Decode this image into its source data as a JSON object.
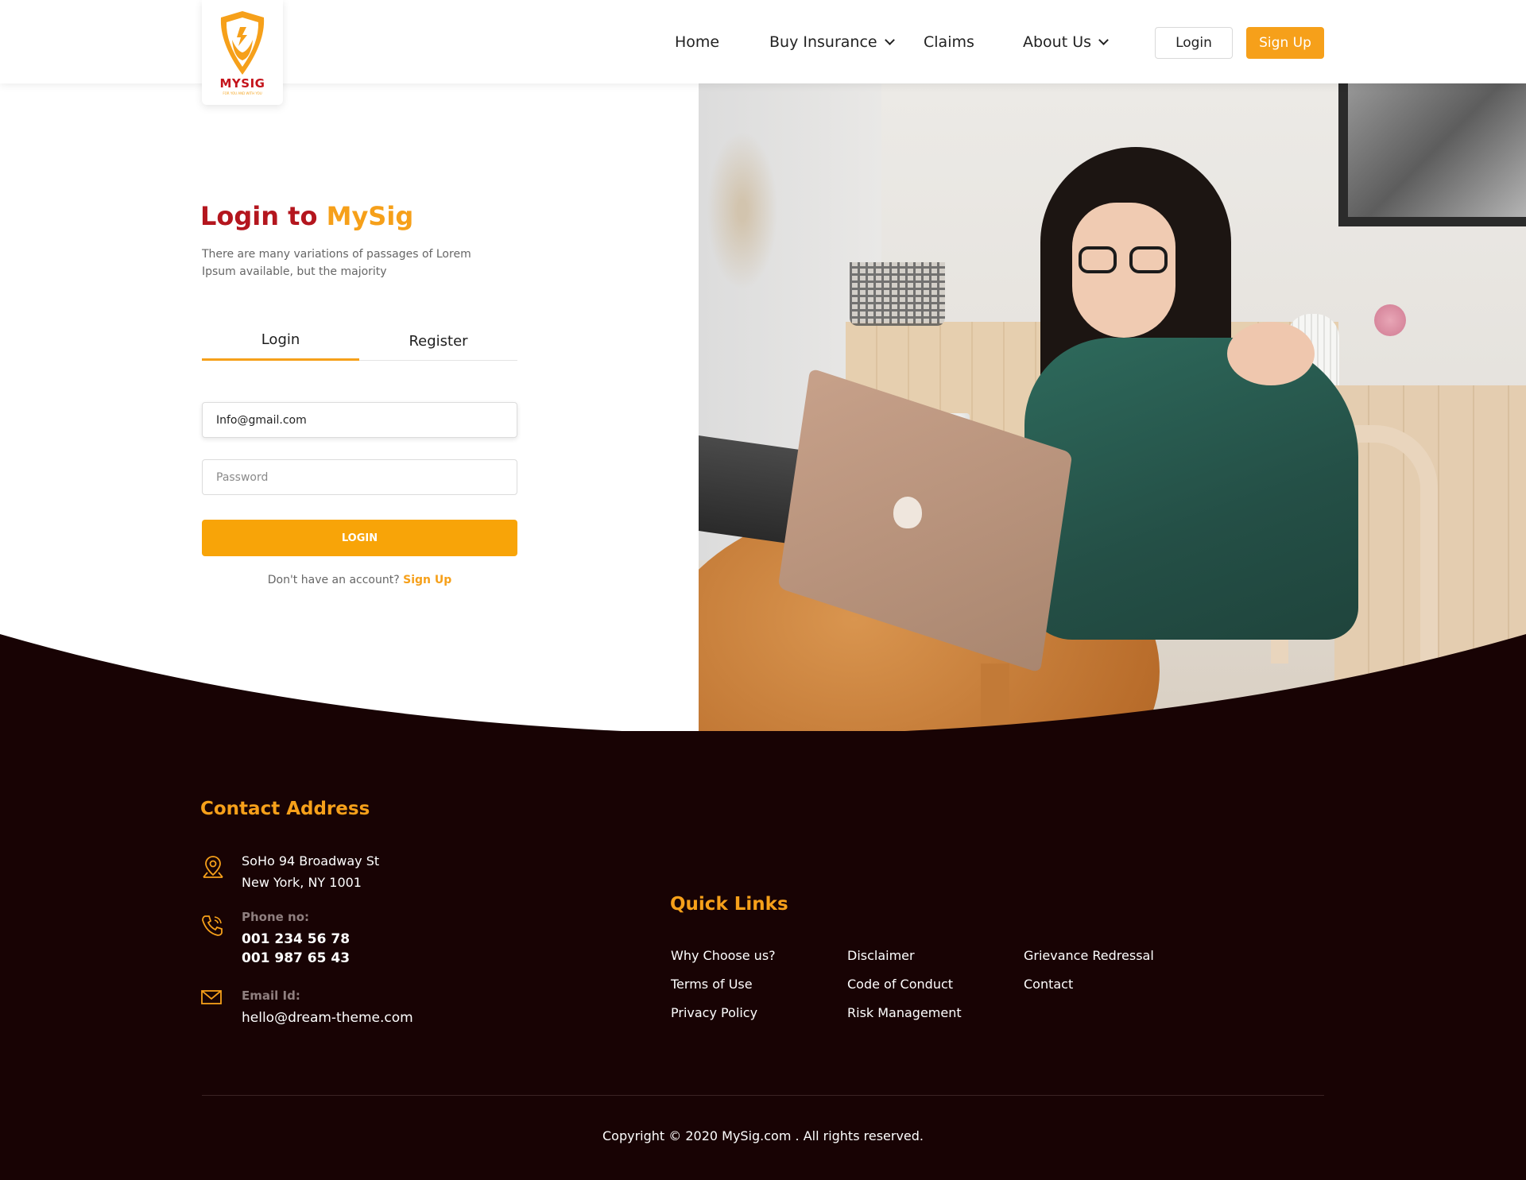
{
  "brand": {
    "name": "MYSIG",
    "tagline": "FOR YOU AND WITH YOU",
    "primary_color": "#f6a01a",
    "accent_red": "#b4161e",
    "footer_bg": "#180304"
  },
  "nav": {
    "items": [
      {
        "label": "Home",
        "has_dropdown": false
      },
      {
        "label": "Buy Insurance",
        "has_dropdown": true
      },
      {
        "label": "Claims",
        "has_dropdown": false
      },
      {
        "label": "About Us",
        "has_dropdown": true
      }
    ],
    "login_label": "Login",
    "signup_label": "Sign Up"
  },
  "login": {
    "title_prefix": "Login to",
    "title_brand": "MySig",
    "description": "There are many variations of passages of Lorem Ipsum available, but the majority",
    "tabs": [
      {
        "label": "Login",
        "active": true
      },
      {
        "label": "Register",
        "active": false
      }
    ],
    "email_value": "Info@gmail.com",
    "password_placeholder": "Password",
    "submit_label": "LOGIN",
    "no_account_text": "Don't have an account?",
    "signup_link": "Sign Up"
  },
  "footer": {
    "contact": {
      "title": "Contact Address",
      "address_line1": "SoHo 94 Broadway St",
      "address_line2": "New York, NY 1001",
      "phone_label": "Phone no:",
      "phone1": "001 234 56 78",
      "phone2": "001 987 65 43",
      "email_label": "Email Id:",
      "email": "hello@dream-theme.com"
    },
    "quick_links": {
      "title": "Quick Links",
      "col1": [
        "Why Choose us?",
        "Terms of Use",
        "Privacy Policy"
      ],
      "col2": [
        "Disclaimer",
        "Code of Conduct",
        "Risk Management"
      ],
      "col3": [
        "Grievance Redressal",
        "Contact"
      ]
    },
    "copyright": "Copyright © 2020 MySig.com . All rights reserved."
  },
  "icons": [
    "shield-logo-icon",
    "chevron-down-icon",
    "location-pin-icon",
    "phone-icon",
    "mail-icon"
  ]
}
